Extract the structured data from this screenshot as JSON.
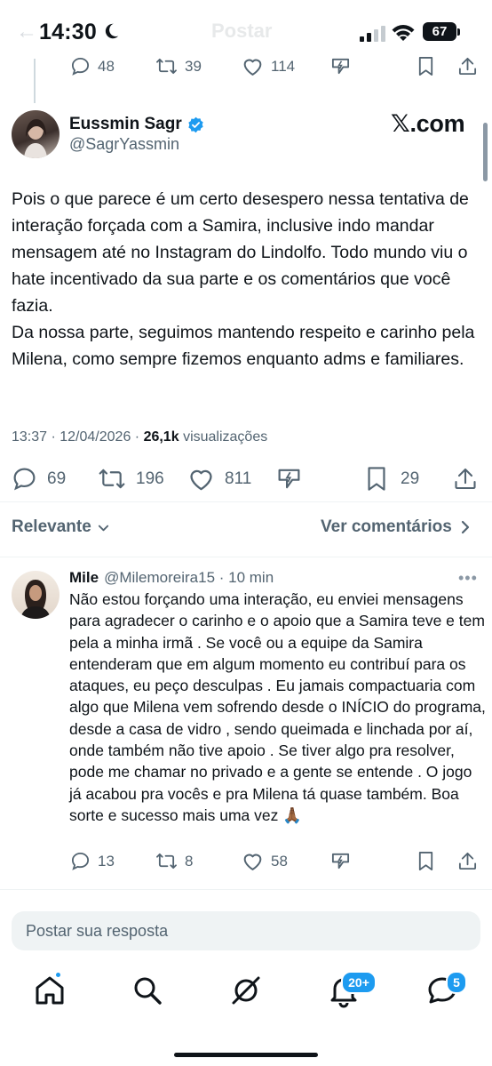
{
  "status_bar": {
    "time": "14:30",
    "battery": "67",
    "header_back_glyph": "←",
    "header_title": "Postar"
  },
  "prev_tweet_actions": {
    "replies": "48",
    "reposts": "39",
    "likes": "114"
  },
  "main_tweet": {
    "author_name": "Eussmin Sagr",
    "author_handle": "@SagrYassmin",
    "watermark": "𝕏.com",
    "text": "Pois o que parece é um certo desespero nessa tentativa de interação forçada com a Samira, inclusive indo mandar mensagem até no Instagram do Lindolfo. Todo mundo viu o hate incentivado da sua parte e os comentários que você fazia.\nDa nossa parte, seguimos mantendo respeito e carinho pela Milena, como sempre fizemos enquanto adms e familiares.",
    "timestamp": "13:37 · 12/04/2026 · ",
    "views_count": "26,1k",
    "views_label": "visualizações",
    "replies": "69",
    "reposts": "196",
    "likes": "811",
    "bookmarks": "29"
  },
  "sort_bar": {
    "sort_label": "Relevante",
    "view_comments": "Ver comentários"
  },
  "reply": {
    "author_name": "Mile",
    "meta": "@Milemoreira15 · 10 min",
    "more": "•••",
    "text": "Não estou forçando uma interação, eu enviei mensagens para agradecer o carinho e o apoio que a Samira teve e tem pela a minha irmã . Se você ou a equipe da Samira entenderam que em algum momento eu contribuí para os ataques, eu peço desculpas . Eu jamais compactuaria com algo que Milena vem sofrendo desde o INÍCIO do programa, desde a casa de vidro , sendo queimada e linchada por aí, onde também não tive apoio . Se tiver algo pra resolver, pode me chamar no privado e a gente se entende . O jogo já acabou pra vocês e pra Milena tá quase também. Boa sorte e sucesso mais uma vez 🙏🏾",
    "replies": "13",
    "reposts": "8",
    "likes": "58"
  },
  "composer": {
    "placeholder": "Postar sua resposta"
  },
  "tab_bar": {
    "notifications_badge": "20+",
    "messages_badge": "5"
  },
  "colors": {
    "text": "#0f1419",
    "secondary": "#536471",
    "accent": "#1d9bf0",
    "verified": "#1d9bf0"
  },
  "icons": [
    "moon-icon",
    "signal-icon",
    "wifi-icon",
    "battery-icon",
    "reply-icon",
    "repost-icon",
    "like-icon",
    "grok-icon",
    "bookmark-icon",
    "share-icon",
    "verified-icon",
    "chevron-down-icon",
    "chevron-right-icon",
    "home-icon",
    "search-icon",
    "grok-tab-icon",
    "bell-icon",
    "messages-icon"
  ]
}
